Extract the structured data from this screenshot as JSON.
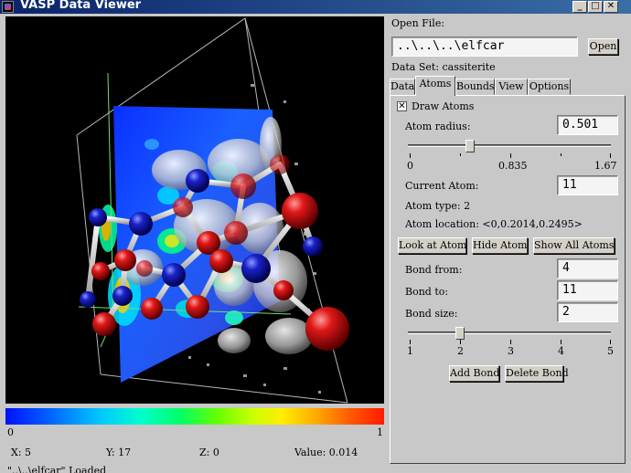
{
  "window": {
    "title": "VASP Data Viewer",
    "min": "_",
    "max": "□",
    "close": "✕"
  },
  "viewport": {
    "colorbar_min": "0",
    "colorbar_max": "1"
  },
  "readout": {
    "x": "X: 5",
    "y": "Y: 17",
    "z": "Z: 0",
    "value": "Value: 0.014"
  },
  "status": "\"..\\..\\elfcar\" Loaded",
  "panel": {
    "open_file_label": "Open File:",
    "file_path": "..\\..\\..\\elfcar",
    "open_button": "Open",
    "dataset": "Data Set: cassiterite",
    "tabs": [
      "Data",
      "Atoms",
      "Bounds",
      "View",
      "Options"
    ],
    "active_tab": "Atoms",
    "draw_atoms_label": "Draw Atoms",
    "draw_atoms_checked": true,
    "check_mark": "✕",
    "atom_radius_label": "Atom radius:",
    "atom_radius_value": "0.501",
    "radius_slider": {
      "min": "0",
      "mid": "0.835",
      "max": "1.67",
      "value": 0.501,
      "range": [
        0,
        1.67
      ]
    },
    "current_atom_label": "Current Atom:",
    "current_atom_value": "11",
    "atom_type": "Atom type: 2",
    "atom_location": "Atom location: <0,0.2014,0.2495>",
    "look_at_atom": "Look at Atom",
    "hide_atom": "Hide Atom",
    "show_all_atoms": "Show All Atoms",
    "bond_from_label": "Bond from:",
    "bond_from_value": "4",
    "bond_to_label": "Bond to:",
    "bond_to_value": "11",
    "bond_size_label": "Bond size:",
    "bond_size_value": "2",
    "bond_slider": {
      "ticks": [
        "1",
        "2",
        "3",
        "4",
        "5"
      ],
      "value": 2,
      "range": [
        1,
        5
      ]
    },
    "add_bond": "Add Bond",
    "delete_bond": "Delete Bond"
  },
  "colors": {
    "title_bar": "#0a246a",
    "atom_red": "#d01010",
    "atom_blue": "#1018b0",
    "background": "#c8c8c8"
  }
}
